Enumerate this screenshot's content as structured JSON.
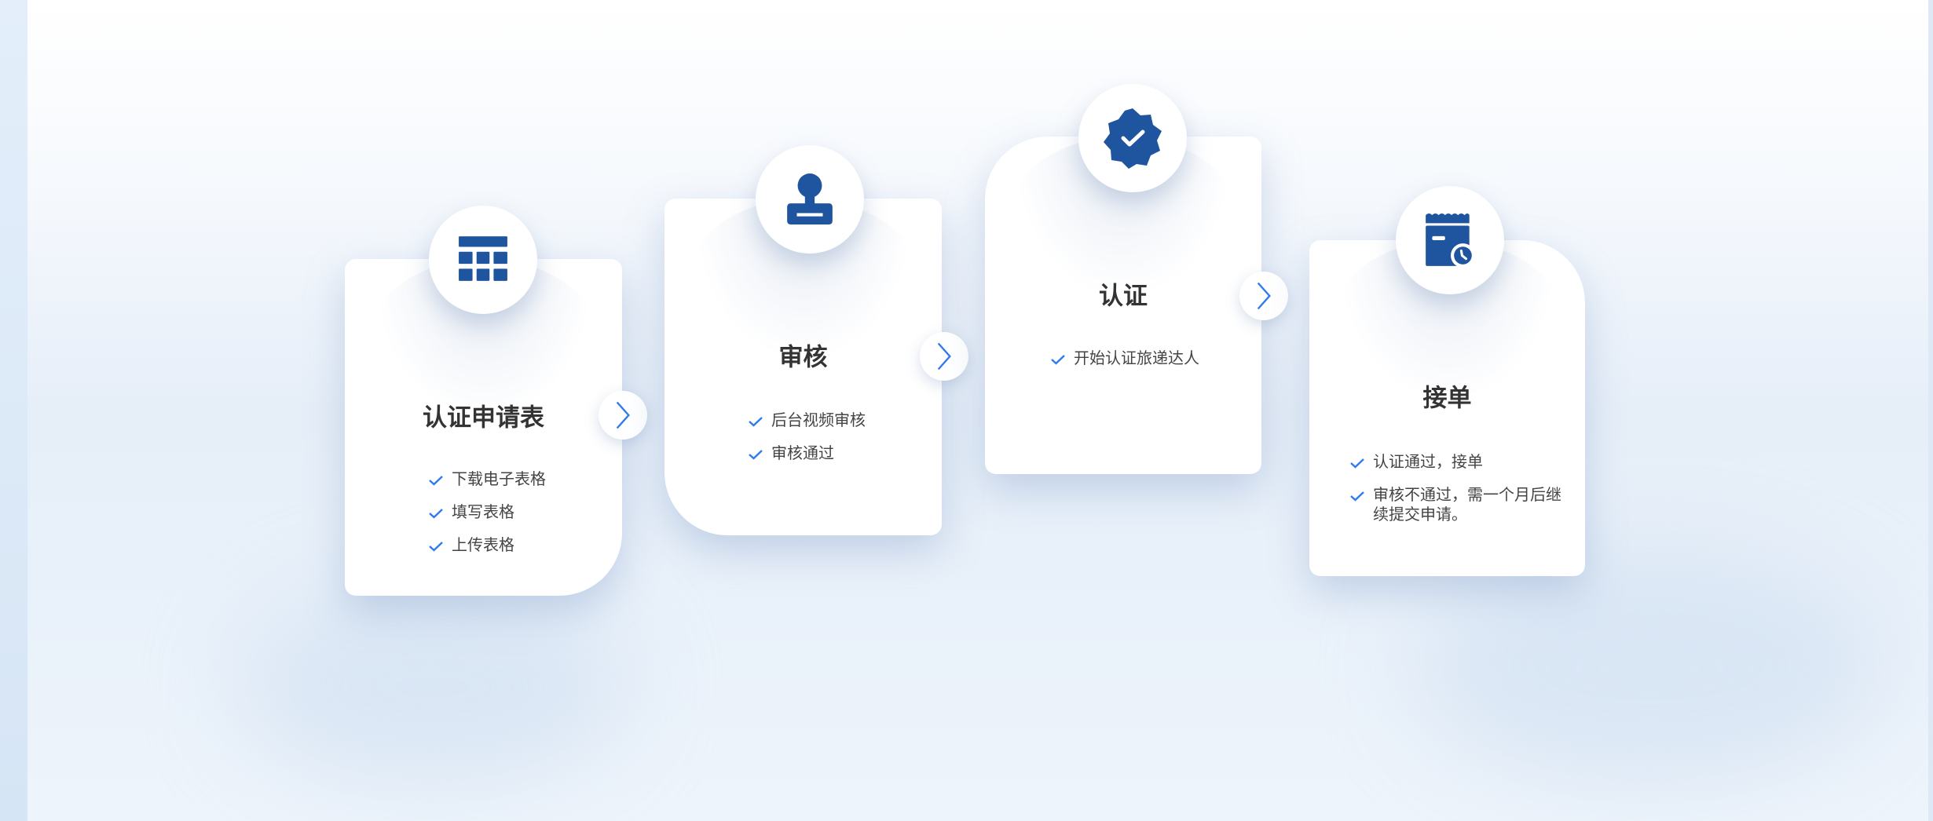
{
  "accent_color": "#2f7af0",
  "icon_color": "#1f559e",
  "steps": [
    {
      "icon": "table-icon",
      "title": "认证申请表",
      "items": [
        "下载电子表格",
        "填写表格",
        "上传表格"
      ]
    },
    {
      "icon": "stamp-icon",
      "title": "审核",
      "items": [
        "后台视频审核",
        "审核通过"
      ]
    },
    {
      "icon": "verified-badge-icon",
      "title": "认证",
      "items": [
        "开始认证旅递达人"
      ]
    },
    {
      "icon": "receipt-clock-icon",
      "title": "接单",
      "items": [
        "认证通过，接单",
        "审核不通过，需一个月后继续提交申请。"
      ]
    }
  ]
}
